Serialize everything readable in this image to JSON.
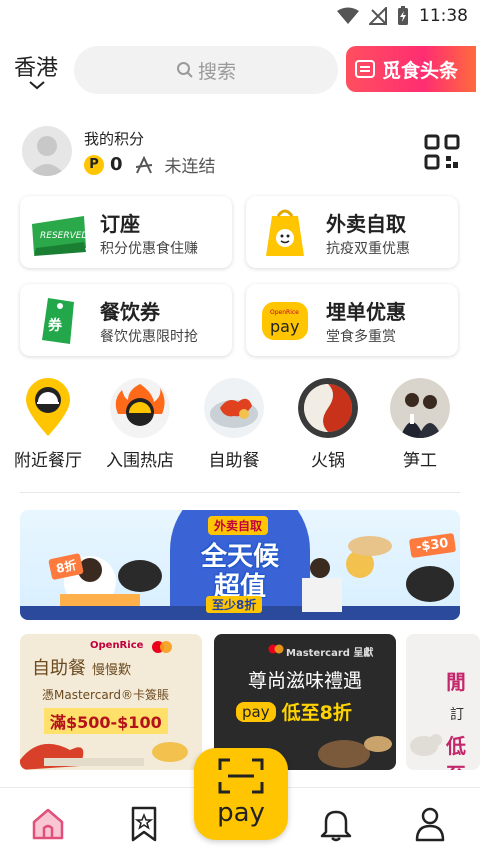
{
  "status_bar": {
    "time": "11:38"
  },
  "header": {
    "city": "香港",
    "search_placeholder": "搜索",
    "headline_button": "觅食头条"
  },
  "points": {
    "title": "我的积分",
    "value": "0",
    "link_status": "未连结"
  },
  "feature_cards": [
    {
      "title": "订座",
      "subtitle": "积分优惠食住赚",
      "icon": "reserved-sign-icon"
    },
    {
      "title": "外卖自取",
      "subtitle": "抗疫双重优惠",
      "icon": "takeaway-bag-icon"
    },
    {
      "title": "餐饮券",
      "subtitle": "餐饮优惠限时抢",
      "icon": "coupon-tag-icon"
    },
    {
      "title": "埋单优惠",
      "subtitle": "堂食多重赏",
      "icon": "openrice-pay-icon"
    }
  ],
  "categories": [
    {
      "label": "附近餐厅",
      "icon": "nearby-pin-icon"
    },
    {
      "label": "入围热店",
      "icon": "hot-bowl-icon"
    },
    {
      "label": "自助餐",
      "icon": "buffet-lobster-icon"
    },
    {
      "label": "火锅",
      "icon": "hotpot-icon"
    },
    {
      "label": "笋工",
      "icon": "staff-photo-icon"
    }
  ],
  "banner": {
    "tag": "外卖自取",
    "line1": "全天候",
    "line2": "超值",
    "line3": "至少8折",
    "badge_left": "8折",
    "badge_right": "-$30"
  },
  "promos": [
    {
      "logo": "OpenRice",
      "title": "自助餐",
      "title_tail": "慢慢歎",
      "subtitle": "憑Mastercard®卡簽賬",
      "price": "滿$500-$100"
    },
    {
      "logo": "Mastercard 呈獻",
      "title": "尊尚滋味禮遇",
      "pay": "pay",
      "discount": "低至8折"
    },
    {
      "title1": "閒",
      "subtitle": "訂",
      "title2": "低至"
    }
  ],
  "bottom_nav": {
    "pay_label": "pay",
    "items": [
      "home",
      "bookmark",
      "pay",
      "notifications",
      "profile"
    ]
  },
  "colors": {
    "brand_yellow": "#ffc600",
    "headline_red": "#ff2e72",
    "home_pink": "#f06a8a"
  }
}
